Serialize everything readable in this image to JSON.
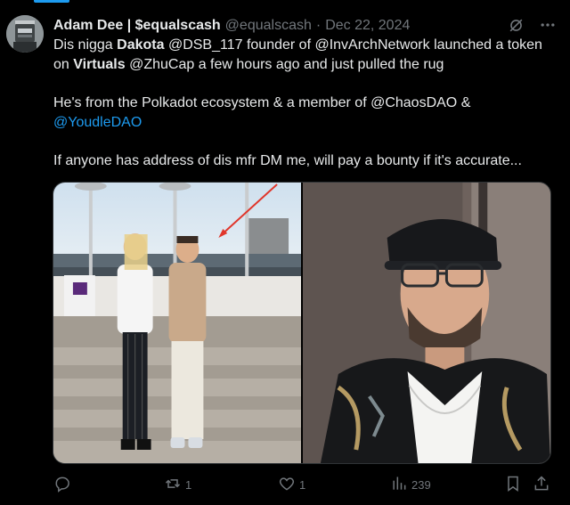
{
  "tweet": {
    "author_name": "Adam Dee | $equalscash",
    "handle": "@equalscash",
    "separator": "·",
    "date": "Dec 22, 2024",
    "paragraph1": {
      "t1": "Dis nigga ",
      "b1": "Dakota",
      "t2": " @DSB_117 founder of @InvArchNetwork launched a token",
      "t3": "on ",
      "b2": "Virtuals",
      "t4": " @ZhuCap a few hours ago and just pulled the rug"
    },
    "paragraph2": {
      "t1": "He's from the Polkadot ecosystem & a member of @ChaosDAO &",
      "link": "@YoudleDAO"
    },
    "paragraph3": "If anyone has address of dis mfr DM me, will pay a bounty if it's accurate..."
  },
  "actions": {
    "reply_count": "",
    "retweet_count": "1",
    "like_count": "1",
    "views_count": "239"
  },
  "icons": {
    "grok": "grok-icon",
    "more": "more-icon",
    "reply": "reply-icon",
    "retweet": "retweet-icon",
    "like": "heart-icon",
    "views": "views-icon",
    "bookmark": "bookmark-icon",
    "share": "share-icon"
  },
  "colors": {
    "background": "#000000",
    "text": "#e7e9ea",
    "muted": "#71767b",
    "link": "#1d9bf0"
  }
}
